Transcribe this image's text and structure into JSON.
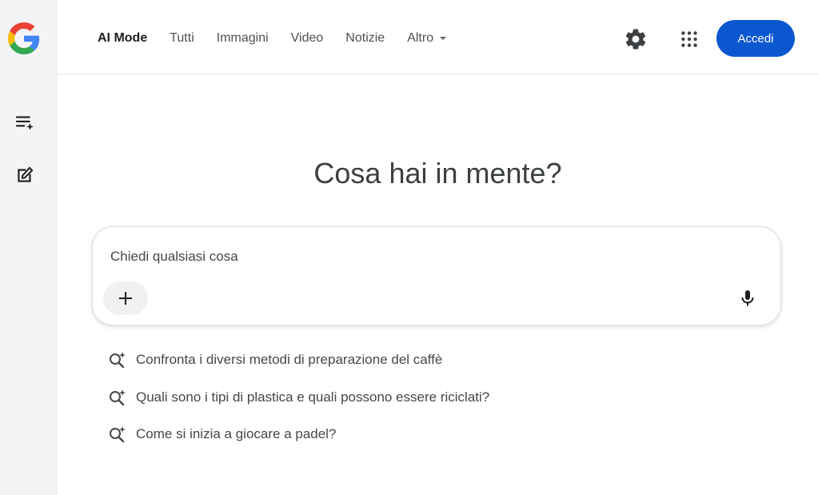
{
  "colors": {
    "accent": "#0b57d0",
    "sidebar_bg": "#f3f4f6",
    "text_primary": "#1f1f1f",
    "text_secondary": "#474747"
  },
  "sidebar": {
    "logo_icon": "google-g-logo",
    "items": [
      {
        "icon": "playlist-sparkle-icon",
        "name": "history"
      },
      {
        "icon": "edit-square-icon",
        "name": "new-chat"
      }
    ]
  },
  "header": {
    "tabs": [
      {
        "label": "AI Mode",
        "active": true
      },
      {
        "label": "Tutti"
      },
      {
        "label": "Immagini"
      },
      {
        "label": "Video"
      },
      {
        "label": "Notizie"
      },
      {
        "label": "Altro"
      }
    ],
    "settings_icon": "gear-icon",
    "apps_icon": "apps-grid-icon",
    "signin_label": "Accedi"
  },
  "main": {
    "headline": "Cosa hai in mente?",
    "search": {
      "placeholder": "Chiedi qualsiasi cosa",
      "value": "",
      "add_icon": "plus-icon",
      "mic_icon": "microphone-icon"
    },
    "suggestions": [
      {
        "text": "Confronta i diversi metodi di preparazione del caffè",
        "icon": "search-sparkle-icon"
      },
      {
        "text": "Quali sono i tipi di plastica e quali possono essere riciclati?",
        "icon": "search-sparkle-icon"
      },
      {
        "text": "Come si inizia a giocare a padel?",
        "icon": "search-sparkle-icon"
      }
    ]
  }
}
